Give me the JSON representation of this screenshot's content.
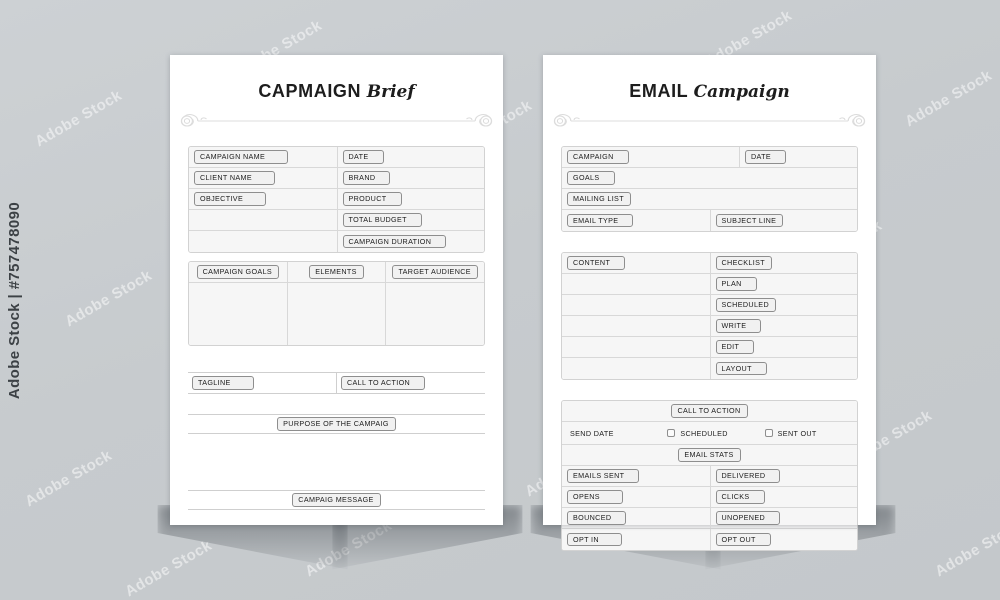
{
  "stock": {
    "id_strip": "Adobe Stock | #757478090",
    "watermark": "Adobe Stock"
  },
  "pages": [
    {
      "id": "campaign-brief",
      "title_bold": "CAPMAIGN",
      "title_script": "Brief",
      "info_rows": [
        {
          "left": "CAMPAIGN NAME",
          "right": "DATE"
        },
        {
          "left": "CLIENT NAME",
          "right": "BRAND"
        },
        {
          "left": "OBJECTIVE",
          "right": "PRODUCT"
        },
        {
          "left": "",
          "right": "TOTAL BUDGET"
        },
        {
          "left": "",
          "right": "CAMPAIGN DURATION"
        }
      ],
      "columns": [
        "CAMPAIGN GOALS",
        "ELEMENTS",
        "TARGET AUDIENCE"
      ],
      "tagline_label": "TAGLINE",
      "cta_label": "CALL TO ACTION",
      "purpose_label": "PURPOSE OF THE CAMPAIG",
      "message_label": "CAMPAIG MESSAGE"
    },
    {
      "id": "email-campaign",
      "title_bold": "EMAIL",
      "title_script": "Campaign",
      "info_rows": [
        {
          "left": "CAMPAIGN",
          "right": "DATE",
          "split": true
        },
        {
          "left": "GOALS",
          "right": "",
          "split": false
        },
        {
          "left": "MAILING LIST",
          "right": "",
          "split": false
        },
        {
          "left": "EMAIL TYPE",
          "right": "SUBJECT LINE",
          "split": true
        }
      ],
      "content_header_left": "CONTENT",
      "content_header_right": "CHECKLIST",
      "checklist": [
        "PLAN",
        "SCHEDULED",
        "WRITE",
        "EDIT",
        "LAYOUT"
      ],
      "cta_label": "CALL TO ACTION",
      "send_date_label": "SEND DATE",
      "checkboxes": [
        "SCHEDULED",
        "SENT OUT"
      ],
      "stats_header": "EMAIL STATS",
      "stats_rows": [
        {
          "left": "EMAILS SENT",
          "right": "DELIVERED"
        },
        {
          "left": "OPENS",
          "right": "CLICKS"
        },
        {
          "left": "BOUNCED",
          "right": "UNOPENED"
        },
        {
          "left": "OPT IN",
          "right": "OPT OUT"
        }
      ]
    }
  ],
  "colors": {
    "backdrop": "#c9cdd0",
    "sheet": "#ffffff",
    "row_fill": "#f6f6f6",
    "border": "#d8d8d8",
    "tag_border": "#8e8e8e",
    "text": "#1c1c1c"
  }
}
